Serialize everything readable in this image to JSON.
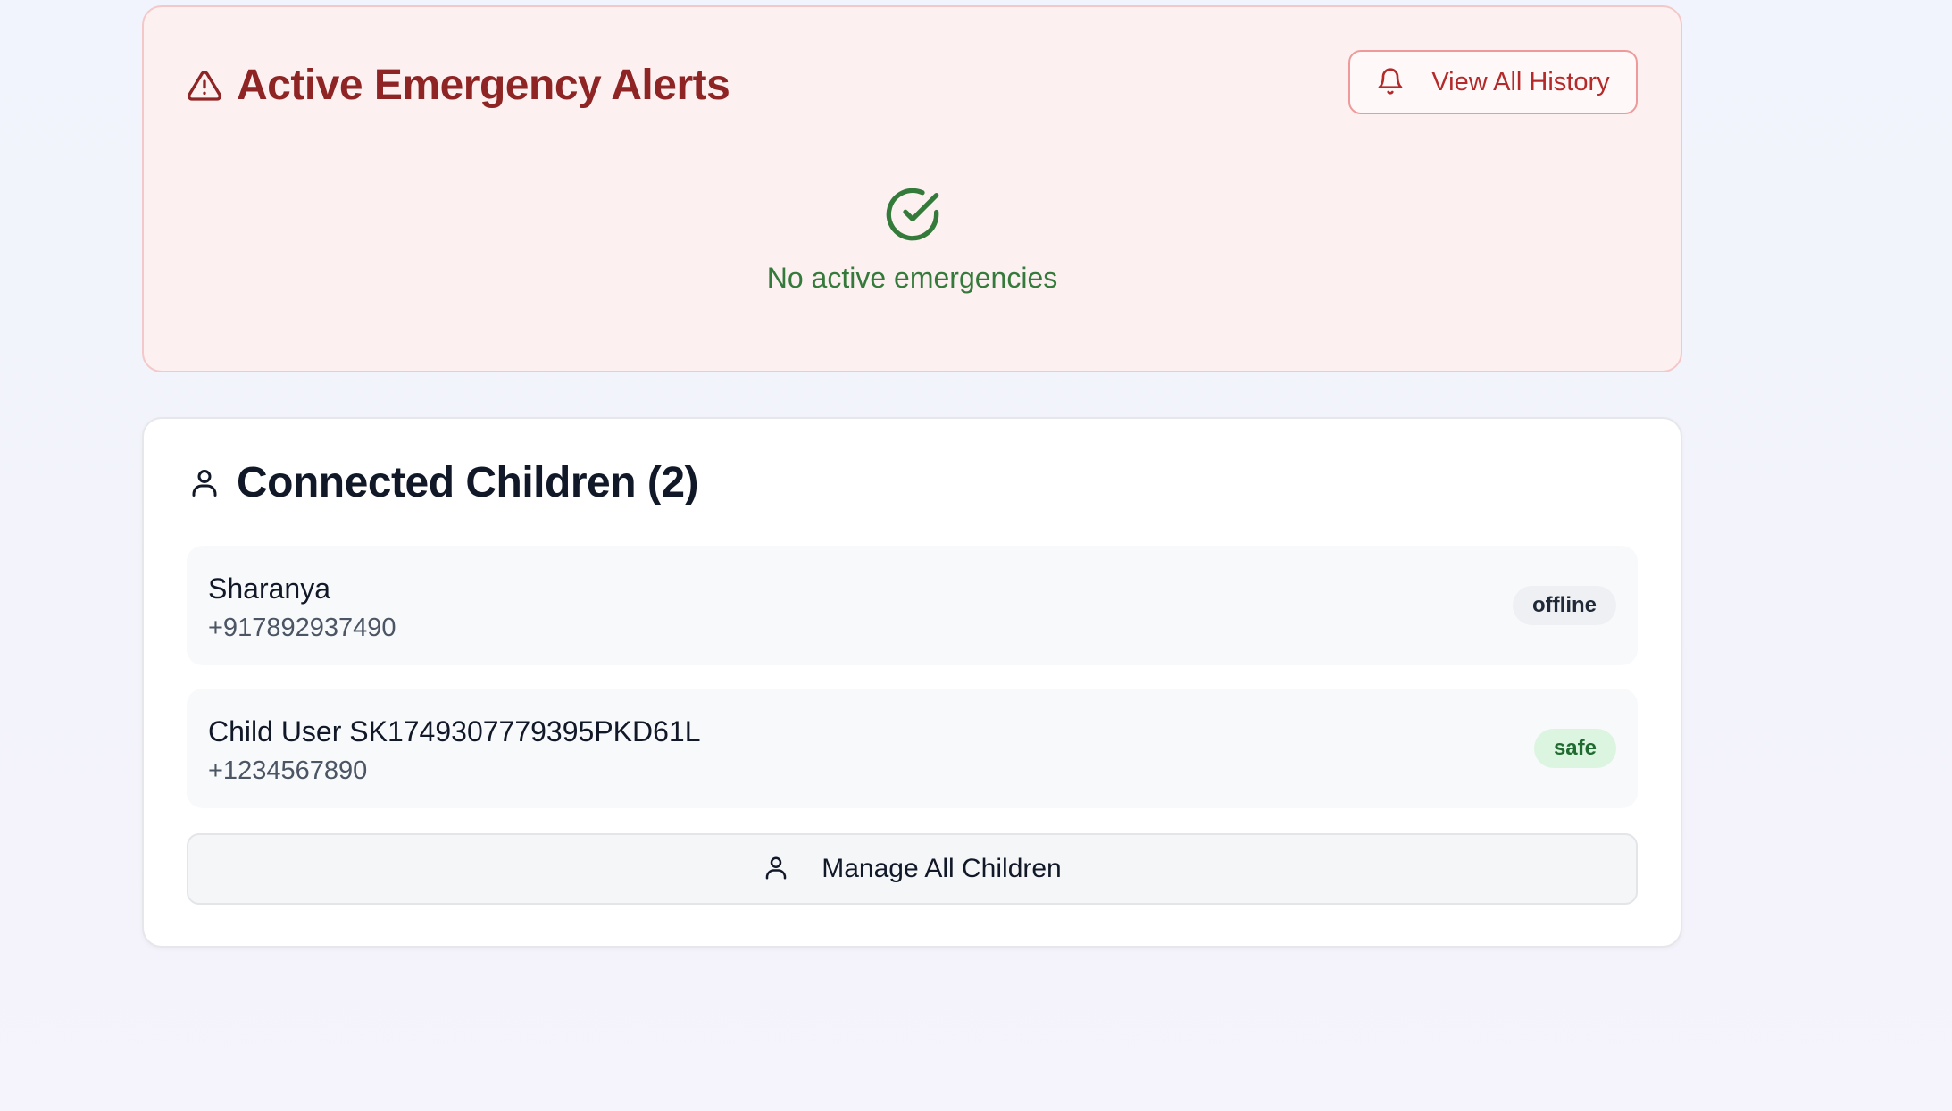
{
  "alerts": {
    "title": "Active Emergency Alerts",
    "icon": "warning-triangle-icon",
    "history_button_label": "View All History",
    "history_button_icon": "bell-icon",
    "empty_state_icon": "check-circle-icon",
    "empty_state_text": "No active emergencies",
    "colors": {
      "title": "#8f2424",
      "background": "#fcf0f0",
      "success": "#347a3a"
    }
  },
  "children": {
    "title": "Connected Children (2)",
    "icon": "user-icon",
    "items": [
      {
        "name": "Sharanya",
        "phone": "+917892937490",
        "status": "offline"
      },
      {
        "name": "Child User SK1749307779395PKD61L",
        "phone": "+1234567890",
        "status": "safe"
      }
    ],
    "manage_button_label": "Manage All Children",
    "manage_button_icon": "user-icon",
    "colors": {
      "safe_badge": "#dcf5e0",
      "offline_badge": "#eef0f3"
    }
  }
}
